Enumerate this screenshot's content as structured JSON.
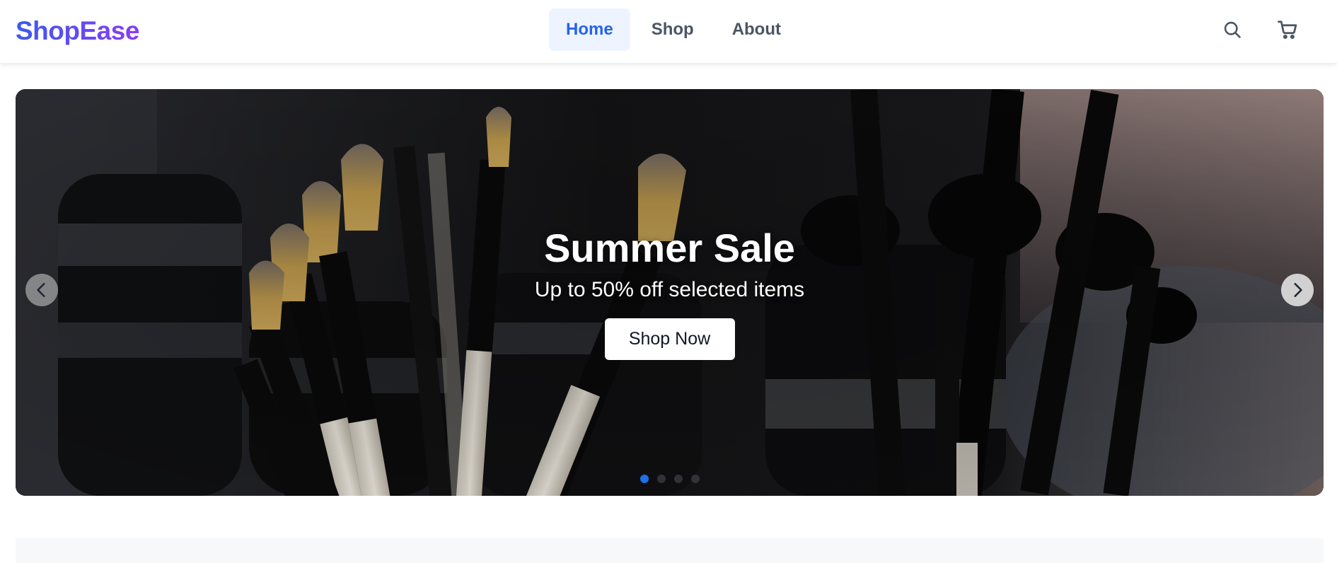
{
  "brand": {
    "logo_text": "ShopEase",
    "gradient_from": "#3b5bf0",
    "gradient_to": "#8a3cf2"
  },
  "nav": {
    "items": [
      {
        "label": "Home",
        "active": true
      },
      {
        "label": "Shop",
        "active": false
      },
      {
        "label": "About",
        "active": false
      }
    ],
    "active_color": "#2563eb",
    "active_bg": "#eef4ff"
  },
  "header_actions": {
    "search_icon": "search-icon",
    "cart_icon": "cart-icon"
  },
  "hero": {
    "title": "Summer Sale",
    "subtitle": "Up to 50% off selected items",
    "cta_label": "Shop Now",
    "prev_icon": "chevron-left-icon",
    "next_icon": "chevron-right-icon",
    "slide_count": 4,
    "active_slide": 1,
    "active_dot_color": "#1e6fe8",
    "image_subject": "makeup brushes"
  }
}
